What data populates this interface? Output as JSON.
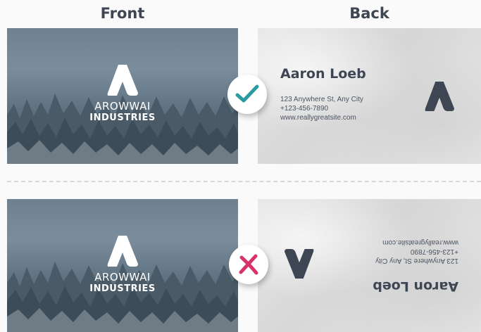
{
  "headers": {
    "front": "Front",
    "back": "Back"
  },
  "brand": {
    "line1": "AROWWAI",
    "line2": "INDUSTRIES"
  },
  "contact_card": {
    "name": "Aaron Loeb",
    "address": "123 Anywhere St, Any City",
    "phone": "+123-456-7890",
    "website": "www.reallygreatsite.com"
  },
  "rows": [
    {
      "verdict": "correct",
      "back_orientation": "upright",
      "icon": "check-icon"
    },
    {
      "verdict": "incorrect",
      "back_orientation": "upside-down",
      "icon": "cross-icon"
    }
  ],
  "colors": {
    "text_dark": "#3d4652",
    "check": "#2a9ba0",
    "cross": "#d6336c",
    "card_back": "#dedede"
  }
}
